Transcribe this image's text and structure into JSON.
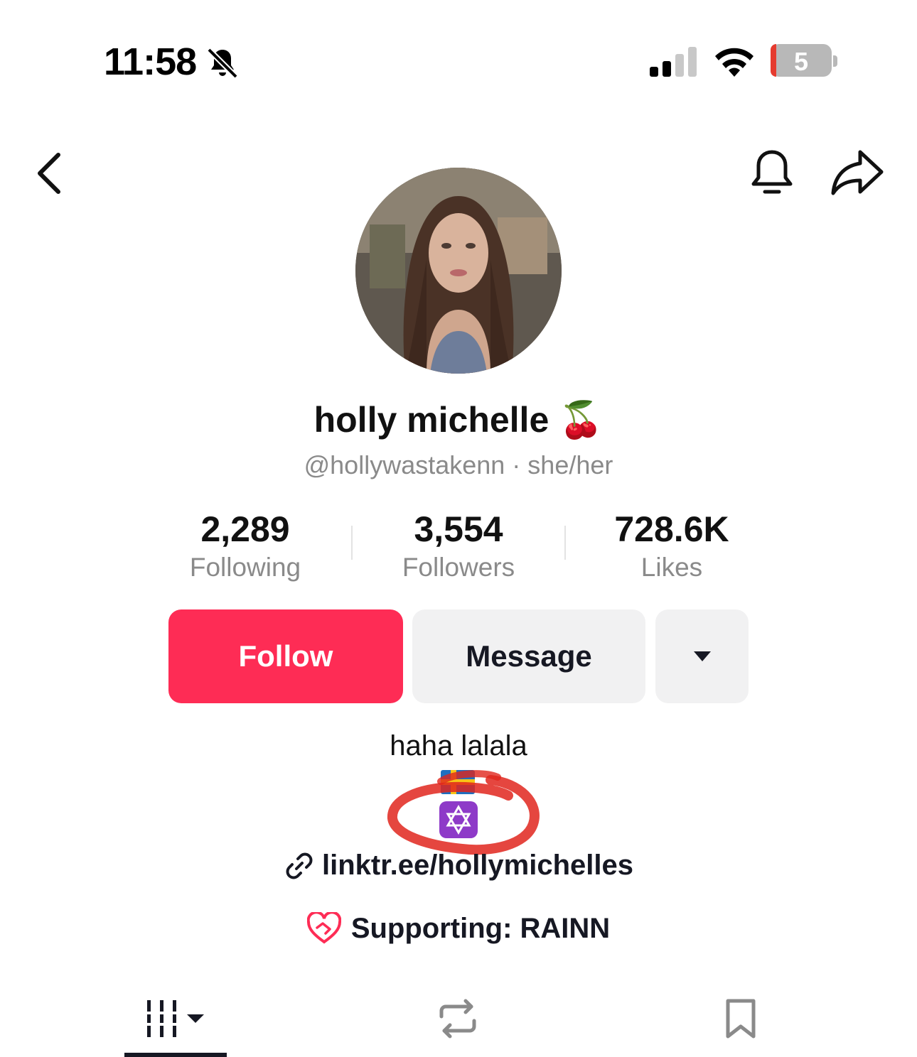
{
  "status_bar": {
    "time": "11:58",
    "battery": "5",
    "icons": [
      "bell-slash-icon",
      "cellular-signal-icon",
      "wifi-icon",
      "battery-icon"
    ]
  },
  "nav": {
    "icons": [
      "chevron-left-icon",
      "bell-icon",
      "share-arrow-icon"
    ]
  },
  "profile": {
    "display_name": "holly michelle 🍒",
    "handle_line": "@hollywastakenn · she/her"
  },
  "stats": [
    {
      "value": "2,289",
      "label": "Following"
    },
    {
      "value": "3,554",
      "label": "Followers"
    },
    {
      "value": "728.6K",
      "label": "Likes"
    }
  ],
  "actions": {
    "follow_label": "Follow",
    "message_label": "Message",
    "colors": {
      "follow": "#fe2c55",
      "secondary": "#f1f1f2"
    }
  },
  "bio": {
    "text": "haha lalala",
    "emojis": [
      "swedish-flag-emoji",
      "star-of-david-emoji"
    ],
    "link": "linktr.ee/hollymichelles",
    "supporting": "Supporting: RAINN"
  },
  "tabs": {
    "items": [
      "videos-grid-icon",
      "repost-icon",
      "bookmark-icon"
    ],
    "active": 0
  }
}
